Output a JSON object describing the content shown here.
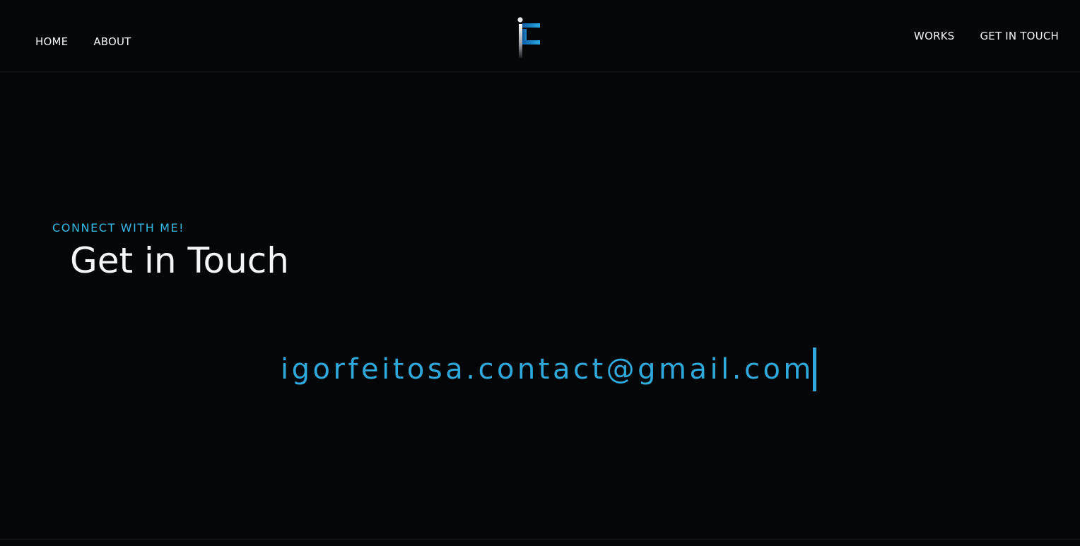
{
  "nav": {
    "left": [
      {
        "label": "HOME"
      },
      {
        "label": "ABOUT"
      }
    ],
    "right": [
      {
        "label": "WORKS"
      },
      {
        "label": "GET IN TOUCH"
      }
    ]
  },
  "logo": {
    "text": "IF",
    "accent": "#1e90d6"
  },
  "contact": {
    "eyebrow": "CONNECT WITH ME!",
    "heading": "Get in Touch",
    "email": "igorfeitosa.contact@gmail.com"
  },
  "colors": {
    "background": "#050608",
    "accent": "#2fa9dc",
    "text": "#f4f5f7"
  }
}
